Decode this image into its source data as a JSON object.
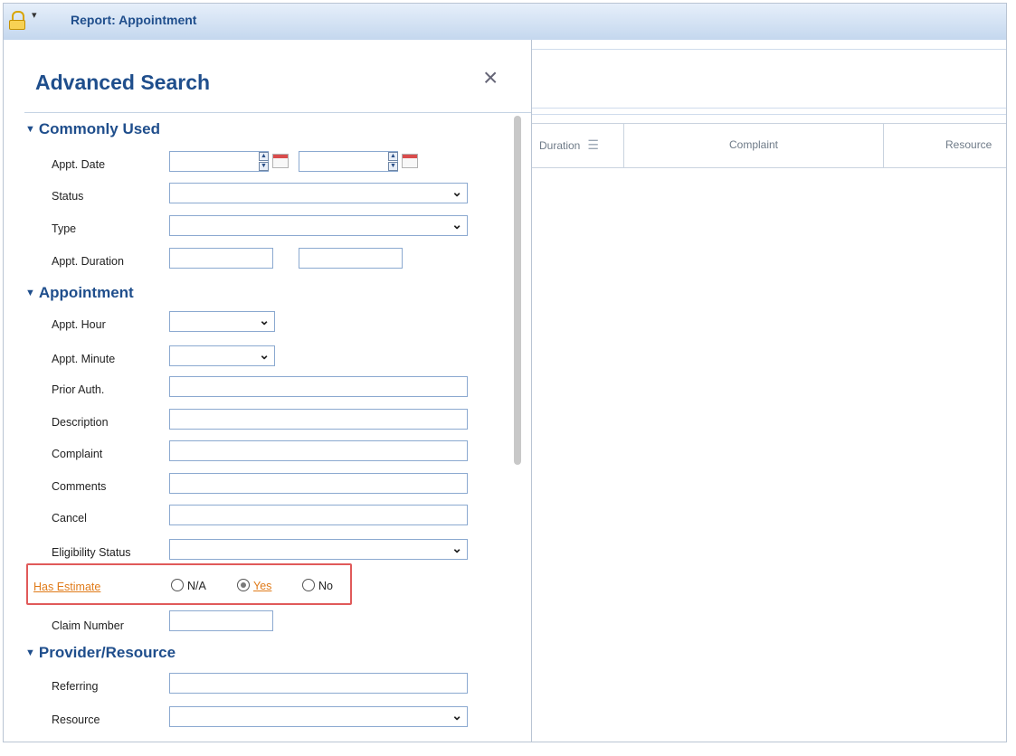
{
  "window": {
    "title": "Report: Appointment"
  },
  "panel": {
    "title": "Advanced Search",
    "close_glyph": "×"
  },
  "grid": {
    "columns": [
      "Duration",
      "Complaint",
      "Resource"
    ]
  },
  "sections": {
    "commonly_used": "Commonly Used",
    "appointment": "Appointment",
    "provider_resource": "Provider/Resource"
  },
  "fields": {
    "appt_date": "Appt. Date",
    "status": "Status",
    "type": "Type",
    "appt_duration": "Appt. Duration",
    "appt_hour": "Appt. Hour",
    "appt_minute": "Appt. Minute",
    "prior_auth": "Prior Auth.",
    "description": "Description",
    "complaint": "Complaint",
    "comments": "Comments",
    "cancel": "Cancel",
    "eligibility_status": "Eligibility Status",
    "has_estimate": "Has Estimate",
    "claim_number": "Claim Number",
    "referring": "Referring",
    "resource": "Resource"
  },
  "has_estimate_options": {
    "na": "N/A",
    "yes": "Yes",
    "no": "No",
    "selected": "Yes"
  },
  "icons": {
    "lock": "lock-icon",
    "dropdown": "chevron-down-icon",
    "calendar": "calendar-icon"
  },
  "colors": {
    "accent": "#1f4e8c",
    "link": "#e07b1a",
    "highlight": "#e05a5a"
  }
}
